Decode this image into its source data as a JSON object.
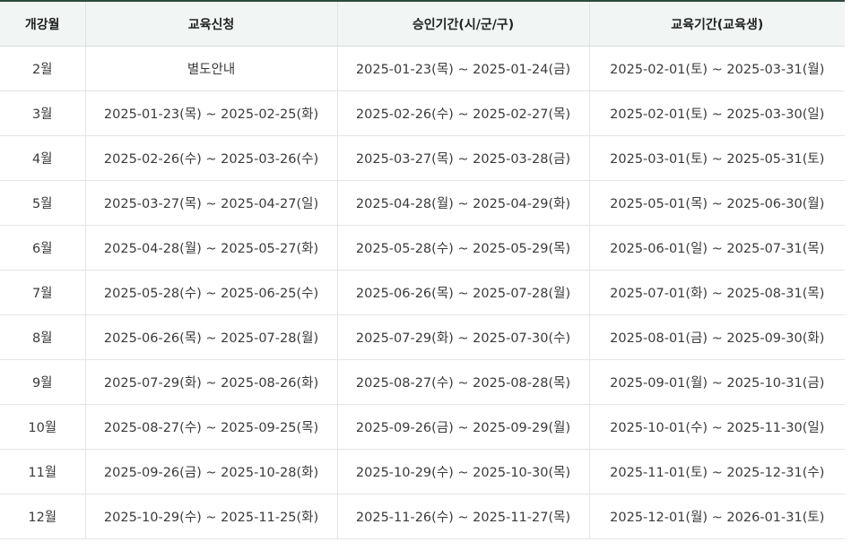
{
  "table": {
    "headers": [
      "개강월",
      "교육신청",
      "승인기간(시/군/구)",
      "교육기간(교육생)"
    ],
    "rows": [
      [
        "2월",
        "별도안내",
        "2025-01-23(목) ~ 2025-01-24(금)",
        "2025-02-01(토) ~ 2025-03-31(월)"
      ],
      [
        "3월",
        "2025-01-23(목) ~ 2025-02-25(화)",
        "2025-02-26(수) ~ 2025-02-27(목)",
        "2025-02-01(토) ~ 2025-03-30(일)"
      ],
      [
        "4월",
        "2025-02-26(수) ~ 2025-03-26(수)",
        "2025-03-27(목) ~ 2025-03-28(금)",
        "2025-03-01(토) ~ 2025-05-31(토)"
      ],
      [
        "5월",
        "2025-03-27(목) ~ 2025-04-27(일)",
        "2025-04-28(월) ~ 2025-04-29(화)",
        "2025-05-01(목) ~ 2025-06-30(월)"
      ],
      [
        "6월",
        "2025-04-28(월) ~ 2025-05-27(화)",
        "2025-05-28(수) ~ 2025-05-29(목)",
        "2025-06-01(일) ~ 2025-07-31(목)"
      ],
      [
        "7월",
        "2025-05-28(수) ~ 2025-06-25(수)",
        "2025-06-26(목) ~ 2025-07-28(월)",
        "2025-07-01(화) ~ 2025-08-31(목)"
      ],
      [
        "8월",
        "2025-06-26(목) ~ 2025-07-28(월)",
        "2025-07-29(화) ~ 2025-07-30(수)",
        "2025-08-01(금) ~ 2025-09-30(화)"
      ],
      [
        "9월",
        "2025-07-29(화) ~ 2025-08-26(화)",
        "2025-08-27(수) ~ 2025-08-28(목)",
        "2025-09-01(월) ~ 2025-10-31(금)"
      ],
      [
        "10월",
        "2025-08-27(수) ~ 2025-09-25(목)",
        "2025-09-26(금) ~ 2025-09-29(월)",
        "2025-10-01(수) ~ 2025-11-30(일)"
      ],
      [
        "11월",
        "2025-09-26(금) ~ 2025-10-28(화)",
        "2025-10-29(수) ~ 2025-10-30(목)",
        "2025-11-01(토) ~ 2025-12-31(수)"
      ],
      [
        "12월",
        "2025-10-29(수) ~ 2025-11-25(화)",
        "2025-11-26(수) ~ 2025-11-27(목)",
        "2025-12-01(월) ~ 2026-01-31(토)"
      ]
    ]
  },
  "colors": {
    "top_border": "#2e4a3c",
    "header_bg": "#f1f5f4",
    "cell_border": "#e1e6e4"
  }
}
